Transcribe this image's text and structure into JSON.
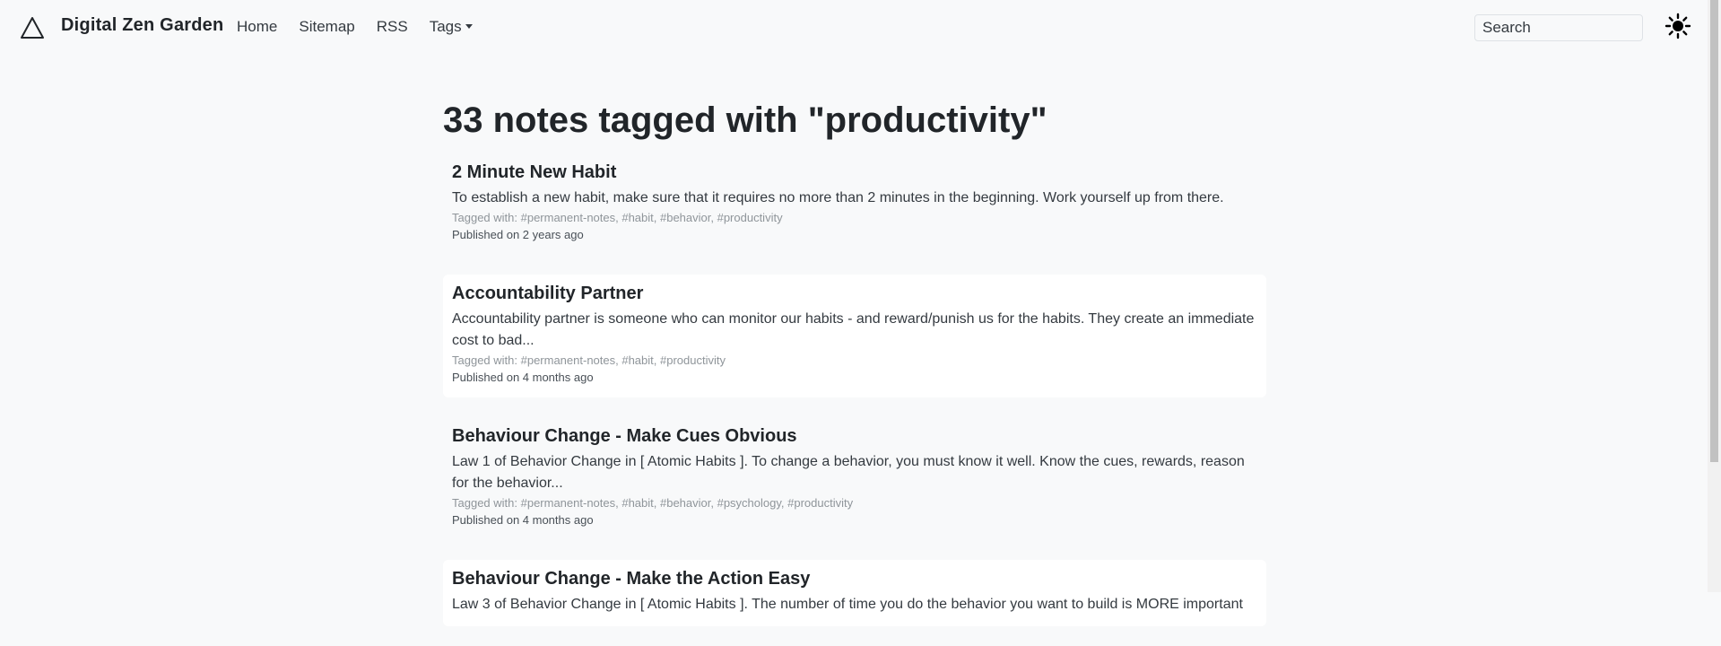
{
  "site": {
    "name": "Digital Zen Garden",
    "logo_icon": "triangle-icon"
  },
  "nav": {
    "items": [
      {
        "label": "Home"
      },
      {
        "label": "Sitemap"
      },
      {
        "label": "RSS"
      },
      {
        "label": "Tags"
      }
    ]
  },
  "search": {
    "placeholder": "Search"
  },
  "theme_toggle": {
    "icon": "sun-icon"
  },
  "page": {
    "title": "33 notes tagged with \"productivity\""
  },
  "notes": [
    {
      "title": "2 Minute New Habit",
      "excerpt": "To establish a new habit, make sure that it requires no more than 2 minutes in the beginning. Work yourself up from there.",
      "tags": "Tagged with: #permanent-notes, #habit, #behavior, #productivity",
      "published": "Published on 2 years ago"
    },
    {
      "title": "Accountability Partner",
      "excerpt": "Accountability partner is someone who can monitor our habits - and reward/punish us for the habits. They create an immediate cost to bad...",
      "tags": "Tagged with: #permanent-notes, #habit, #productivity",
      "published": "Published on 4 months ago"
    },
    {
      "title": "Behaviour Change - Make Cues Obvious",
      "excerpt": "Law 1 of Behavior Change in [ Atomic Habits ]. To change a behavior, you must know it well. Know the cues, rewards, reason for the behavior...",
      "tags": "Tagged with: #permanent-notes, #habit, #behavior, #psychology, #productivity",
      "published": "Published on 4 months ago"
    },
    {
      "title": "Behaviour Change - Make the Action Easy",
      "excerpt": "Law 3 of Behavior Change in [ Atomic Habits ]. The number of time you do the behavior you want to build is MORE important",
      "tags": "",
      "published": ""
    }
  ],
  "colors": {
    "background": "#f8f9fa",
    "card_alt": "#ffffff",
    "text": "#212529",
    "muted": "#8f959a"
  }
}
